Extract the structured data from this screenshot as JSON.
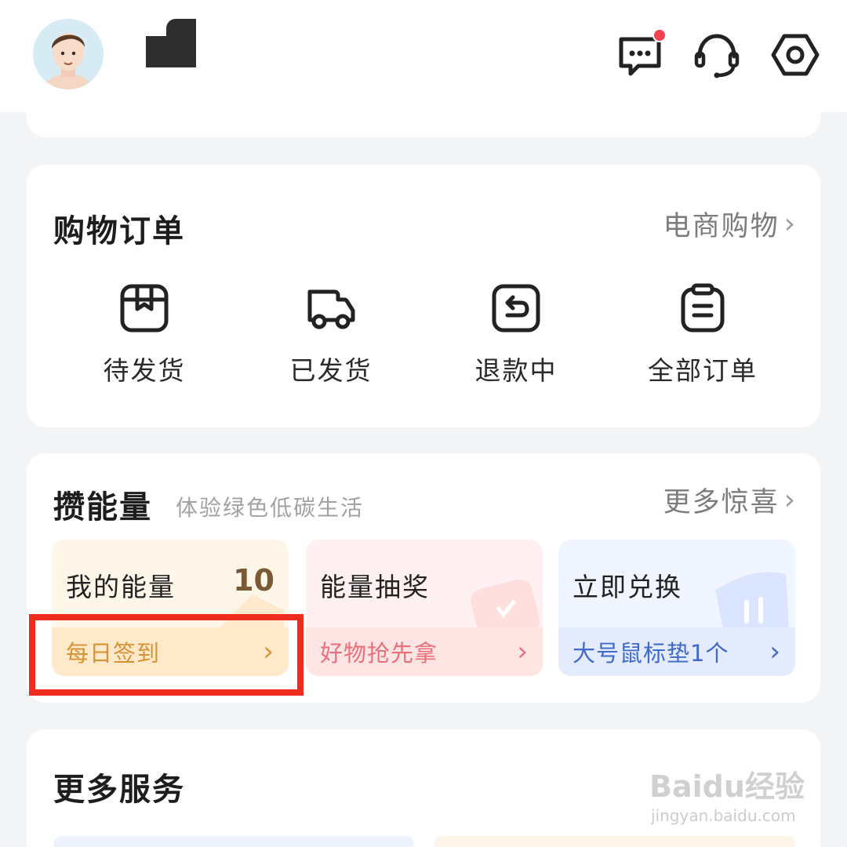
{
  "header": {
    "avatar": "user-avatar",
    "icons": [
      "message-icon",
      "customer-service-icon",
      "settings-icon"
    ],
    "has_unread": true
  },
  "orders": {
    "title": "购物订单",
    "link_label": "电商购物",
    "items": [
      {
        "label": "待发货",
        "icon": "package-icon"
      },
      {
        "label": "已发货",
        "icon": "truck-icon"
      },
      {
        "label": "退款中",
        "icon": "return-icon"
      },
      {
        "label": "全部订单",
        "icon": "clipboard-icon"
      }
    ]
  },
  "energy": {
    "title": "攒能量",
    "subtitle": "体验绿色低碳生活",
    "link_label": "更多惊喜",
    "tiles": [
      {
        "title": "我的能量",
        "value": "10",
        "action": "每日签到"
      },
      {
        "title": "能量抽奖",
        "action": "好物抢先拿"
      },
      {
        "title": "立即兑换",
        "action": "大号鼠标垫1个"
      }
    ]
  },
  "more_services": {
    "title": "更多服务"
  },
  "watermark": {
    "brand": "Baidu经验",
    "url": "jingyan.baidu.com"
  },
  "colors": {
    "highlight": "#ee2d1e",
    "badge": "#f2414f",
    "energy_orange": "#d99233",
    "energy_red": "#e9707a",
    "energy_blue": "#3f6ac9"
  }
}
